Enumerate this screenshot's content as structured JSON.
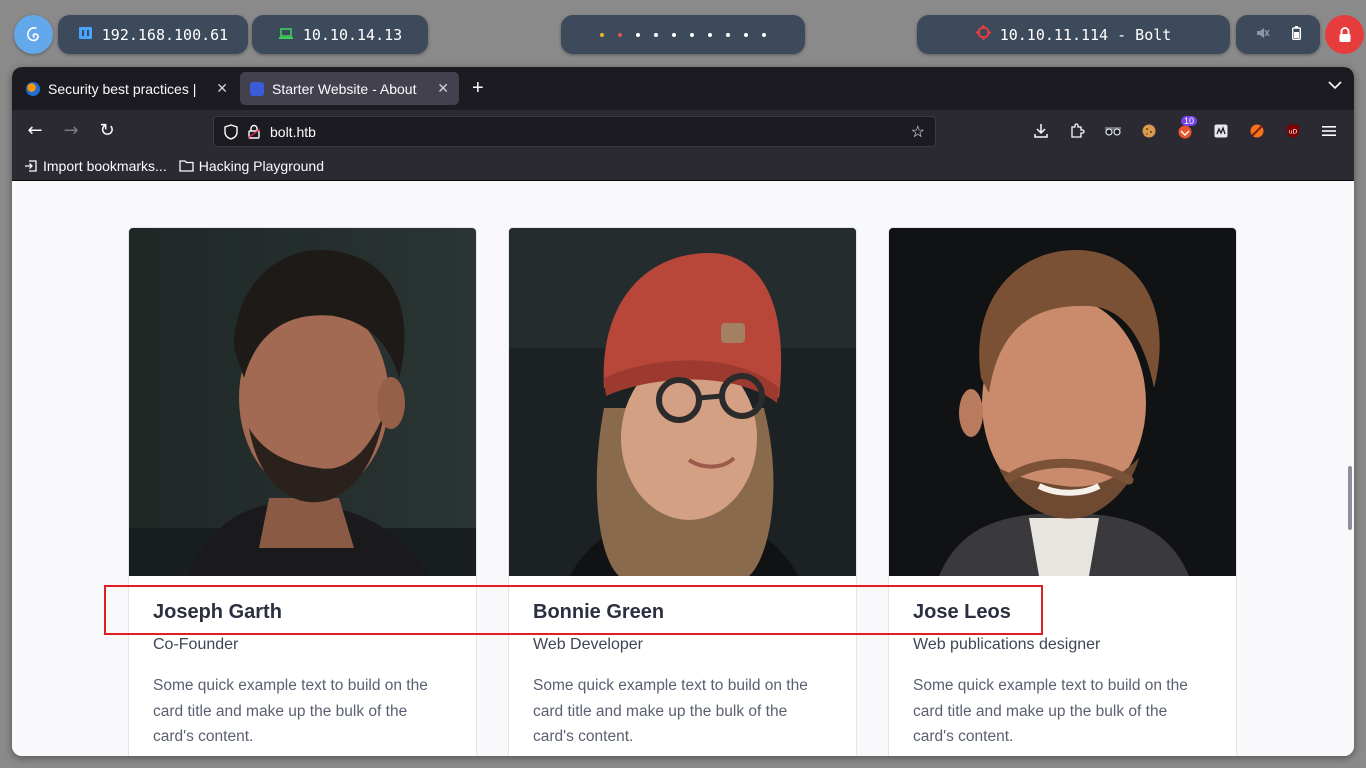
{
  "taskbar": {
    "lan_ip": "192.168.100.61",
    "vpn_ip": "10.10.14.13",
    "target": "10.10.11.114 - Bolt",
    "workspace_dots": 10,
    "colors": {
      "pill": "#3d4a5c",
      "power": "#e63c3c",
      "logo": "#64a8ec"
    }
  },
  "browser": {
    "tabs": [
      {
        "title": "Security best practices | ",
        "active": false
      },
      {
        "title": "Starter Website - About",
        "active": true
      }
    ],
    "url": "bolt.htb",
    "extension_badge": "10",
    "bookmarks": [
      {
        "label": "Import bookmarks...",
        "icon": "import-icon"
      },
      {
        "label": "Hacking Playground",
        "icon": "folder-icon"
      }
    ]
  },
  "page": {
    "team": [
      {
        "name": "Joseph Garth",
        "role": "Co-Founder",
        "desc": "Some quick example text to build on the card title and make up the bulk of the card's content."
      },
      {
        "name": "Bonnie Green",
        "role": "Web Developer",
        "desc": "Some quick example text to build on the card title and make up the bulk of the card's content."
      },
      {
        "name": "Jose Leos",
        "role": "Web publications designer",
        "desc": "Some quick example text to build on the card title and make up the bulk of the card's content."
      }
    ],
    "highlight_color": "#e02020"
  }
}
